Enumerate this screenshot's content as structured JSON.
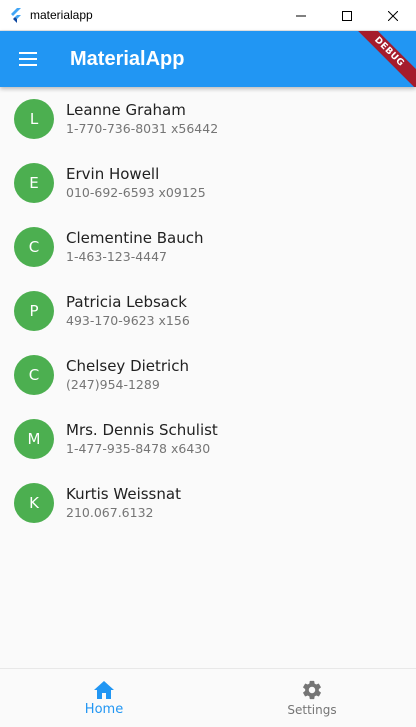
{
  "window": {
    "title": "materialapp"
  },
  "appbar": {
    "title": "MaterialApp",
    "debug_banner": "DEBUG",
    "color": "#2196f3"
  },
  "contacts": [
    {
      "initial": "L",
      "name": "Leanne Graham",
      "phone": "1-770-736-8031 x56442"
    },
    {
      "initial": "E",
      "name": "Ervin Howell",
      "phone": "010-692-6593 x09125"
    },
    {
      "initial": "C",
      "name": "Clementine Bauch",
      "phone": "1-463-123-4447"
    },
    {
      "initial": "P",
      "name": "Patricia Lebsack",
      "phone": "493-170-9623 x156"
    },
    {
      "initial": "C",
      "name": "Chelsey Dietrich",
      "phone": "(247)954-1289"
    },
    {
      "initial": "M",
      "name": "Mrs. Dennis Schulist",
      "phone": "1-477-935-8478 x6430"
    },
    {
      "initial": "K",
      "name": "Kurtis Weissnat",
      "phone": "210.067.6132"
    }
  ],
  "avatar_color": "#4caf50",
  "bottom_nav": {
    "items": [
      {
        "label": "Home",
        "icon": "home-icon",
        "active": true
      },
      {
        "label": "Settings",
        "icon": "gear-icon",
        "active": false
      }
    ]
  }
}
